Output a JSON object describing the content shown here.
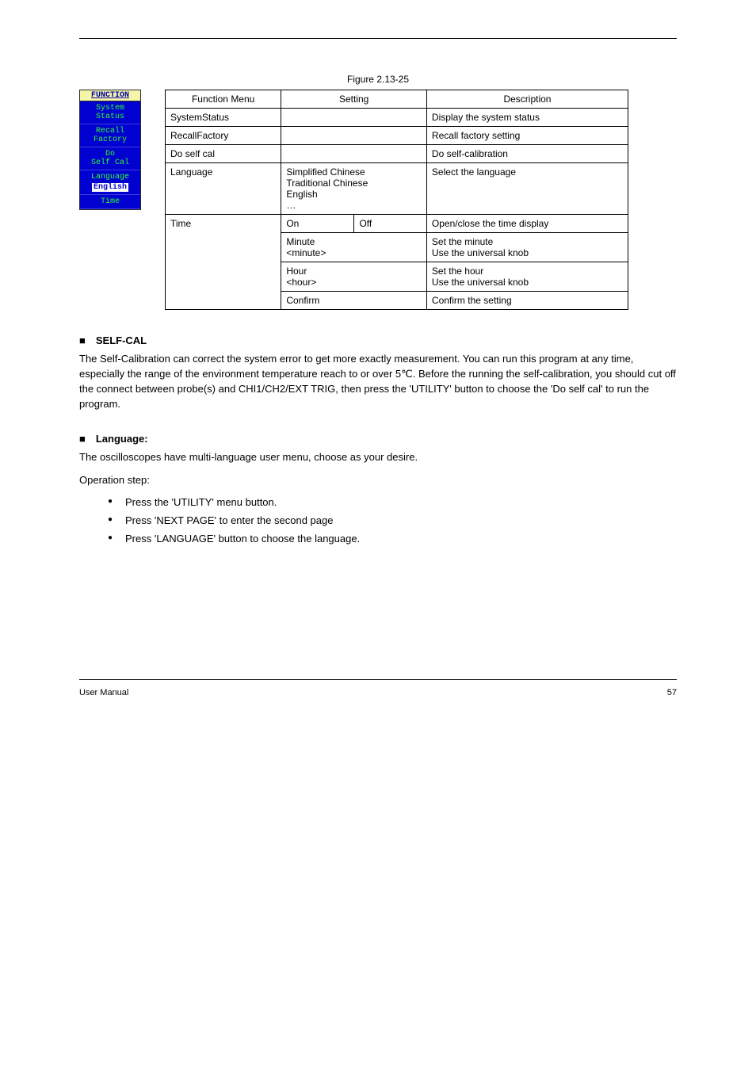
{
  "header": {
    "left": "",
    "right": ""
  },
  "figure_label": "Figure 2.13-25",
  "bios": {
    "title": "FUNCTION",
    "items": [
      {
        "line1": "System",
        "line2": "Status"
      },
      {
        "line1": "Recall",
        "line2": "Factory"
      },
      {
        "line1": "Do",
        "line2": "Self Cal"
      },
      {
        "line1": "Language",
        "selected": "English"
      },
      {
        "line1": "Time"
      }
    ]
  },
  "table": {
    "headers": [
      "Function Menu",
      "Setting",
      "Description"
    ],
    "rows": [
      {
        "menu": "SystemStatus",
        "setting": "",
        "desc": "Display the system status"
      },
      {
        "menu": "RecallFactory",
        "setting": "",
        "desc": "Recall factory setting"
      },
      {
        "menu": "Do self cal",
        "setting": "",
        "desc": "Do self-calibration"
      },
      {
        "menu": "Language",
        "setting_html": "Simplified Chinese<br>Traditional Chinese<br>English<br>…",
        "desc": "Select the language"
      },
      {
        "menu_rowspan": "Time",
        "subrows": [
          {
            "s1": "On",
            "s2": "Off",
            "desc": "Open/close the time display"
          },
          {
            "s1": "Minute",
            "s2_html": "&lt;minute&gt;",
            "desc_html": "Set the minute<br>Use the universal knob"
          },
          {
            "s1": "Hour",
            "s2_html": "&lt;hour&gt;",
            "desc_html": "Set the hour<br>Use the universal knob"
          },
          {
            "s1": "Confirm",
            "s2": "",
            "desc": "Confirm the setting"
          }
        ]
      }
    ]
  },
  "section1": {
    "heading": "■　SELF-CAL",
    "p1_prefix": "The Self-Calibration can correct the system error to get more exactly measurement. You can run this program at any time, especially the range of the environment temperature reach to or over 5",
    "p1_suffix": ". Before the running the self-calibration, you should cut off the connect between probe(s) and CHI1/CH2/EXT TRIG, then press the 'UTILITY' button to choose the 'Do self cal' to run the program.",
    "degree": "℃"
  },
  "section2": {
    "heading": "■　Language:",
    "intro": "The oscilloscopes have multi-language user menu, choose as your desire.",
    "steps_label": "Operation step:",
    "bullets": [
      "Press the 'UTILITY' menu button.",
      "Press 'NEXT PAGE' to enter the second page",
      "Press 'LANGUAGE' button to choose the language."
    ]
  },
  "footer": {
    "left": "User Manual",
    "right": "57"
  }
}
